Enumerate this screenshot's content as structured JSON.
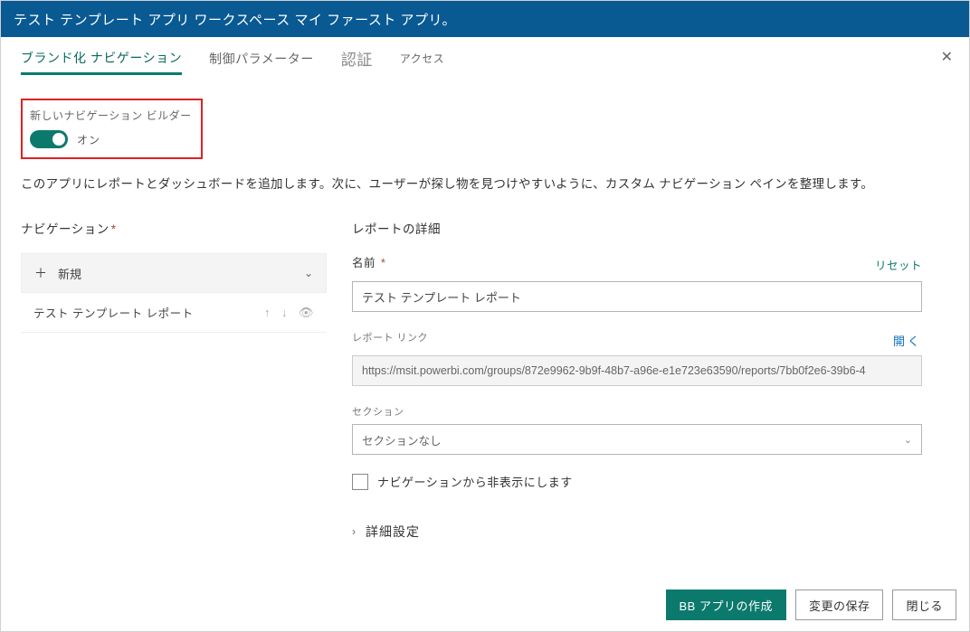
{
  "header": {
    "title": "テスト テンプレート アプリ ワークスペース マイ ファースト アプリ。"
  },
  "tabs": {
    "branding": "ブランド化 ナビゲーション",
    "control": "制御パラメーター",
    "cert": "認証",
    "access": "アクセス"
  },
  "navBuilder": {
    "label": "新しいナビゲーション ビルダー",
    "state": "オン"
  },
  "description": "このアプリにレポートとダッシュボードを追加します。次に、ユーザーが探し物を見つけやすいように、カスタム ナビゲーション ペインを整理します。",
  "leftCol": {
    "heading": "ナビゲーション",
    "newLabel": "新規",
    "item1": "テスト テンプレート レポート"
  },
  "rightCol": {
    "heading": "レポートの詳細",
    "nameLabel": "名前",
    "reset": "リセット",
    "nameValue": "テスト テンプレート レポート",
    "linkLabel": "レポート リンク",
    "open": "開く",
    "linkValue": "https://msit.powerbi.com/groups/872e9962-9b9f-48b7-a96e-e1e723e63590/reports/7bb0f2e6-39b6-4",
    "sectionLabel": "セクション",
    "sectionValue": "セクションなし",
    "hideLabel": "ナビゲーションから非表示にします",
    "advanced": "詳細設定"
  },
  "footer": {
    "create": "BB アプリの作成",
    "save": "変更の保存",
    "close": "閉じる"
  }
}
